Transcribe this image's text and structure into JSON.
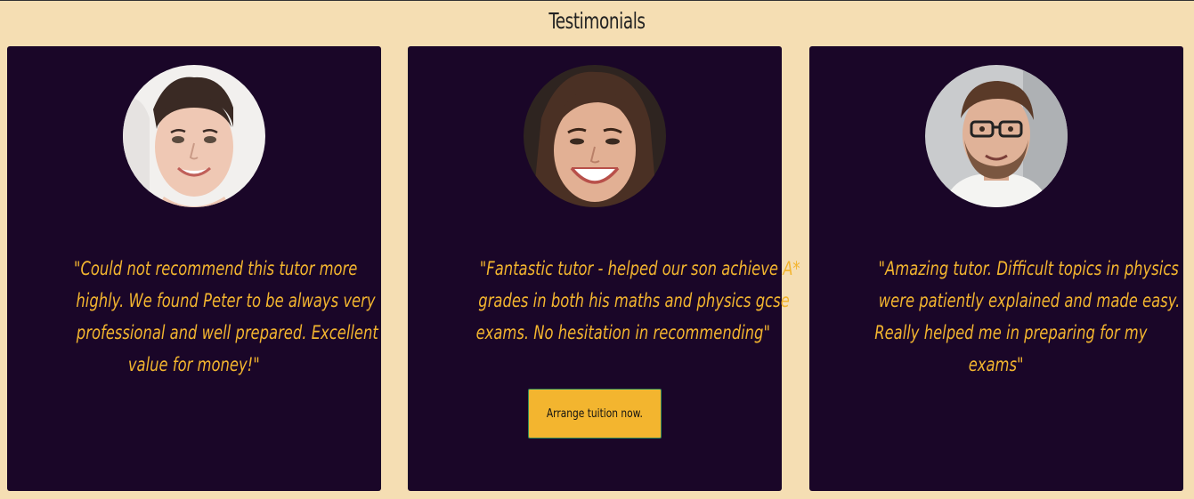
{
  "section": {
    "title": "Testimonials"
  },
  "testimonials": [
    {
      "quote_lines": [
        "\"Could not recommend this tutor more",
        "highly. We found Peter to be always very",
        "professional and well prepared. Excellent",
        "value for money!\""
      ]
    },
    {
      "quote_lines": [
        "\"Fantastic tutor - helped our son achieve A*",
        "grades in both his maths and physics gcse",
        "exams. No hesitation in recommending\""
      ],
      "button_label": "Arrange tuition now."
    },
    {
      "quote_lines": [
        "\"Amazing tutor. Difficult topics in physics",
        "were patiently explained and made easy.",
        "Really helped me in preparing for my",
        "exams\""
      ]
    }
  ],
  "colors": {
    "page_background": "#f5deb3",
    "card_background": "#1a0628",
    "accent": "#f3b52f",
    "button_border": "#2f8a5a"
  }
}
